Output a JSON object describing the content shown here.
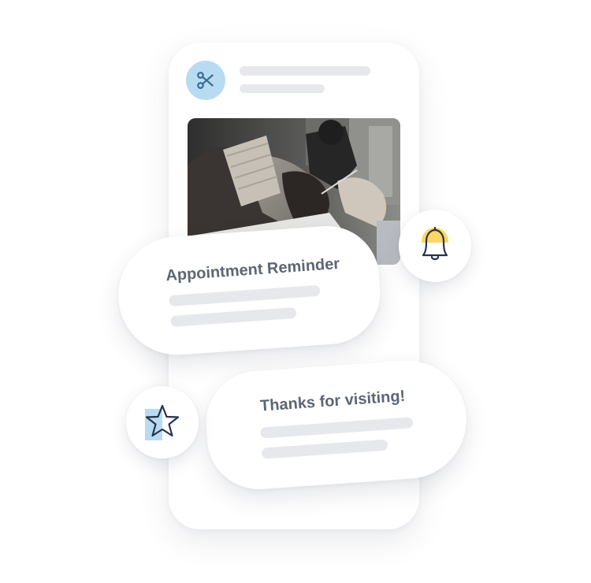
{
  "reminder_card": {
    "title": "Appointment Reminder"
  },
  "thanks_card": {
    "title": "Thanks for visiting!"
  },
  "icons": {
    "header": "scissors-icon",
    "notification": "bell-icon",
    "review": "star-icon"
  },
  "colors": {
    "accent_blue": "#b7dcf2",
    "accent_yellow": "#fcd766",
    "text": "#5d6674",
    "placeholder": "#e7e8ec"
  }
}
